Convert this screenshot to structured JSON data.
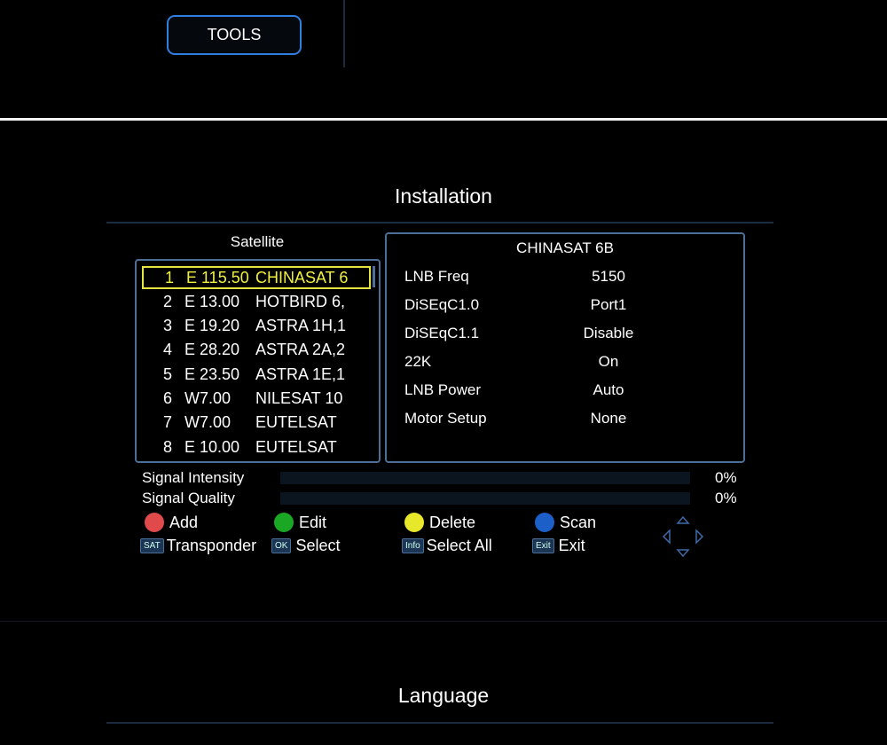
{
  "top": {
    "tools_label": "TOOLS"
  },
  "installation": {
    "title": "Installation",
    "satellite_header": "Satellite",
    "satellites": [
      {
        "num": "1",
        "pos": "E 115.50",
        "name": "CHINASAT 6",
        "selected": true
      },
      {
        "num": "2",
        "pos": "E 13.00",
        "name": "HOTBIRD 6,"
      },
      {
        "num": "3",
        "pos": "E 19.20",
        "name": "ASTRA 1H,1"
      },
      {
        "num": "4",
        "pos": "E 28.20",
        "name": "ASTRA 2A,2"
      },
      {
        "num": "5",
        "pos": "E 23.50",
        "name": "ASTRA 1E,1"
      },
      {
        "num": "6",
        "pos": "W7.00",
        "name": "NILESAT 10"
      },
      {
        "num": "7",
        "pos": "W7.00",
        "name": "EUTELSAT"
      },
      {
        "num": "8",
        "pos": "E 10.00",
        "name": "EUTELSAT"
      }
    ],
    "detail": {
      "title": "CHINASAT 6B",
      "rows": [
        {
          "label": "LNB Freq",
          "value": "5150"
        },
        {
          "label": "DiSEqC1.0",
          "value": "Port1"
        },
        {
          "label": "DiSEqC1.1",
          "value": "Disable"
        },
        {
          "label": "22K",
          "value": "On"
        },
        {
          "label": "LNB Power",
          "value": "Auto"
        },
        {
          "label": "Motor Setup",
          "value": "None"
        }
      ]
    },
    "signal": {
      "intensity_label": "Signal Intensity",
      "intensity_value": "0%",
      "intensity_percent": 0,
      "quality_label": "Signal Quality",
      "quality_value": "0%",
      "quality_percent": 0
    },
    "keys": {
      "add": "Add",
      "edit": "Edit",
      "delete": "Delete",
      "scan": "Scan",
      "sat_btn": "SAT",
      "transponder": "Transponder",
      "ok_btn": "OK",
      "select": "Select",
      "info_btn": "Info",
      "select_all": "Select All",
      "exit_btn": "Exit",
      "exit": "Exit"
    },
    "colors": {
      "red": "#e04a4a",
      "green": "#1aa824",
      "yellow": "#e8e82a",
      "blue": "#1d5fc8",
      "highlight": "#f0f040",
      "border": "#4d6e96"
    }
  },
  "language": {
    "title": "Language"
  }
}
